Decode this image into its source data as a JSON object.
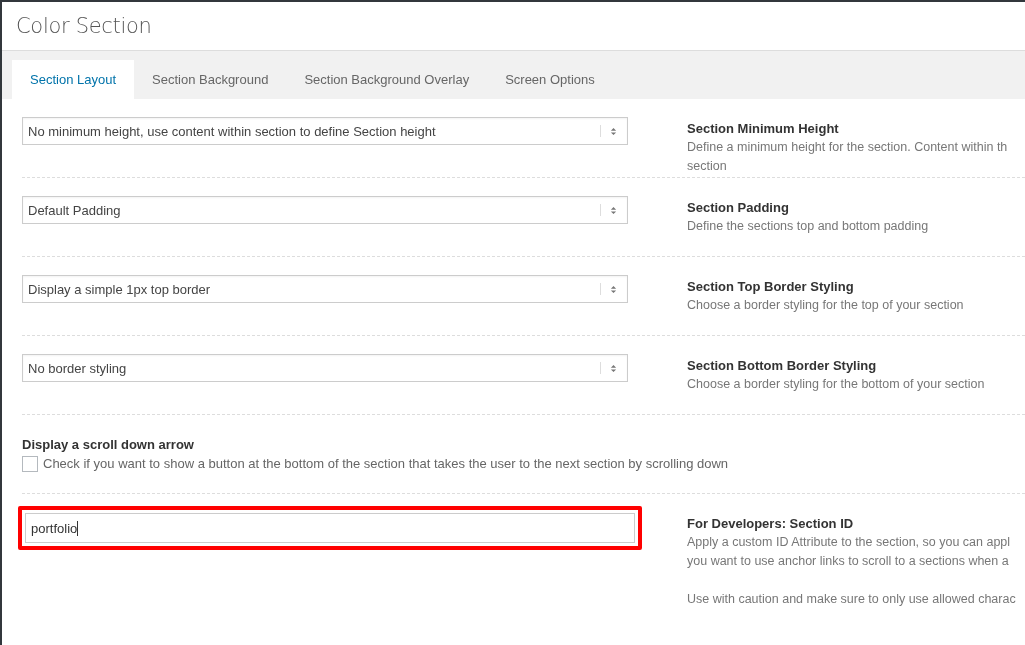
{
  "window": {
    "title": "Color Section"
  },
  "tabs": [
    {
      "label": "Section Layout",
      "selected": true
    },
    {
      "label": "Section Background",
      "selected": false
    },
    {
      "label": "Section Background Overlay",
      "selected": false
    },
    {
      "label": "Screen Options",
      "selected": false
    }
  ],
  "settings": [
    {
      "kind": "select",
      "value": "No minimum height, use content within section to define Section height",
      "title": "Section Minimum Height",
      "description": [
        [
          "Define a minimum height for the section. Content within th",
          "section"
        ]
      ]
    },
    {
      "kind": "select",
      "value": "Default Padding",
      "title": "Section Padding",
      "description": [
        [
          "Define the sections top and bottom padding"
        ]
      ]
    },
    {
      "kind": "select",
      "value": "Display a simple 1px top border",
      "title": "Section Top Border Styling",
      "description": [
        [
          "Choose a border styling for the top of your section"
        ]
      ]
    },
    {
      "kind": "select",
      "value": "No border styling",
      "title": "Section Bottom Border Styling",
      "description": [
        [
          "Choose a border styling for the bottom of your section"
        ]
      ]
    },
    {
      "kind": "checkbox",
      "title": "Display a scroll down arrow",
      "label": "Check if you want to show a button at the bottom of the section that takes the user to the next section by scrolling down",
      "checked": false
    },
    {
      "kind": "text",
      "value": "portfolio",
      "highlighted": true,
      "title": "For Developers: Section ID",
      "description": [
        [
          "Apply a custom ID Attribute to the section, so you can appl",
          "you want to use anchor links to scroll to a sections when a"
        ],
        [
          "Use with caution and make sure to only use allowed charac"
        ]
      ]
    }
  ]
}
